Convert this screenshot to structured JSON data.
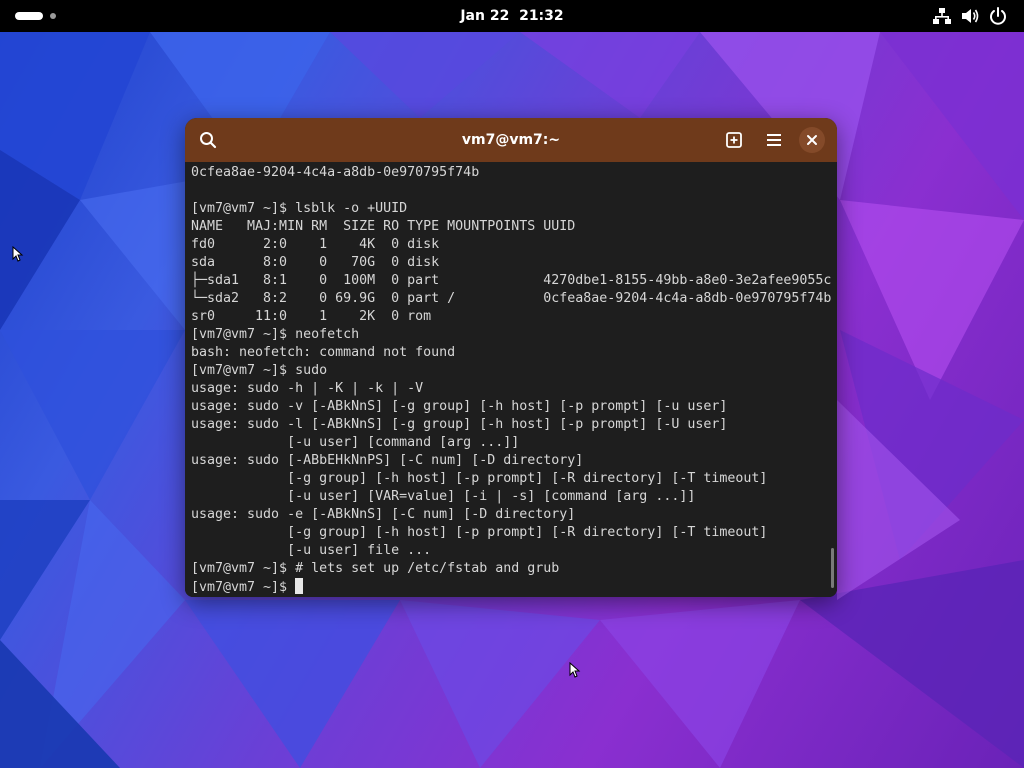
{
  "topbar": {
    "clock": "Jan 22  21:32",
    "icons": [
      "activities-indicator",
      "network-icon",
      "volume-icon",
      "power-icon"
    ]
  },
  "terminal": {
    "title": "vm7@vm7:~",
    "buttons": [
      "search-icon",
      "new-tab-icon",
      "hamburger-menu-icon",
      "close-icon"
    ],
    "lines": [
      "0cfea8ae-9204-4c4a-a8db-0e970795f74b",
      "",
      "[vm7@vm7 ~]$ lsblk -o +UUID",
      "NAME   MAJ:MIN RM  SIZE RO TYPE MOUNTPOINTS UUID",
      "fd0      2:0    1    4K  0 disk",
      "sda      8:0    0   70G  0 disk",
      "├─sda1   8:1    0  100M  0 part             4270dbe1-8155-49bb-a8e0-3e2afee9055c",
      "└─sda2   8:2    0 69.9G  0 part /           0cfea8ae-9204-4c4a-a8db-0e970795f74b",
      "sr0     11:0    1    2K  0 rom",
      "[vm7@vm7 ~]$ neofetch",
      "bash: neofetch: command not found",
      "[vm7@vm7 ~]$ sudo",
      "usage: sudo -h | -K | -k | -V",
      "usage: sudo -v [-ABkNnS] [-g group] [-h host] [-p prompt] [-u user]",
      "usage: sudo -l [-ABkNnS] [-g group] [-h host] [-p prompt] [-U user]",
      "            [-u user] [command [arg ...]]",
      "usage: sudo [-ABbEHkNnPS] [-C num] [-D directory]",
      "            [-g group] [-h host] [-p prompt] [-R directory] [-T timeout]",
      "            [-u user] [VAR=value] [-i | -s] [command [arg ...]]",
      "usage: sudo -e [-ABkNnS] [-C num] [-D directory]",
      "            [-g group] [-h host] [-p prompt] [-R directory] [-T timeout]",
      "            [-u user] file ...",
      "[vm7@vm7 ~]$ # lets set up /etc/fstab and grub"
    ],
    "prompt": "[vm7@vm7 ~]$ "
  },
  "colors": {
    "titlebar": "#6f3a1b",
    "terminal_bg": "#1e1e1e",
    "terminal_fg": "#d6d6d6",
    "topbar": "#000000"
  }
}
